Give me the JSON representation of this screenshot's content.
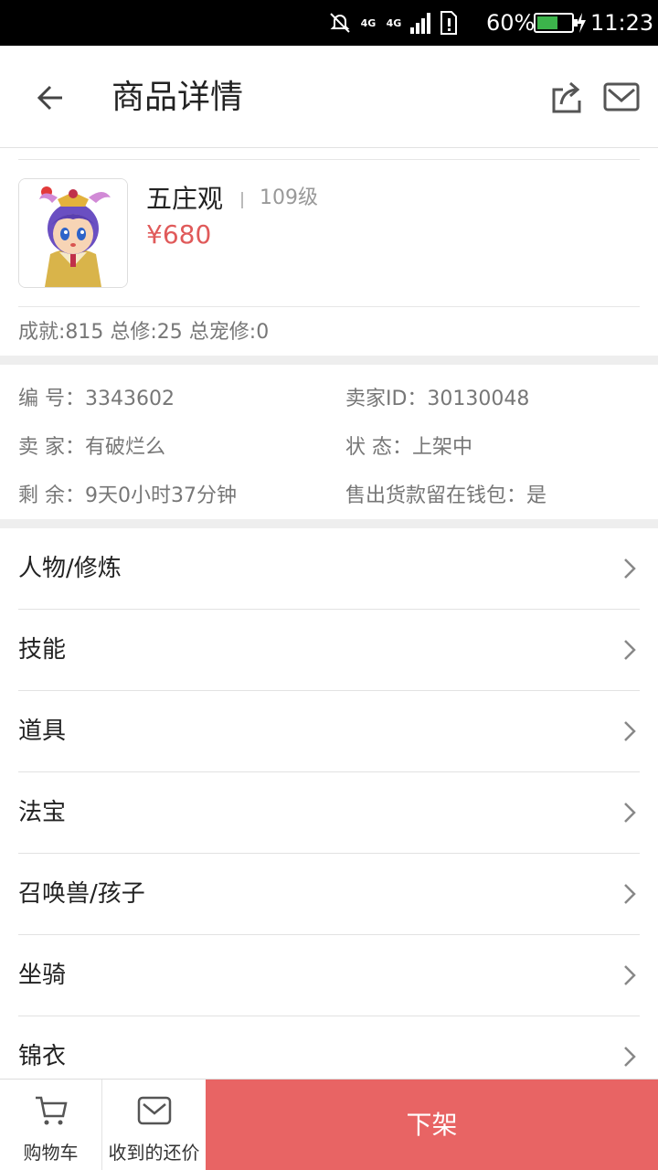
{
  "status_bar": {
    "network_left": "4G",
    "network_right": "4G",
    "battery_percent": "60%",
    "battery_level": 0.6,
    "time": "11:23",
    "icons": [
      "mute-notification-icon",
      "signal-icon",
      "sim-alert-icon",
      "battery-icon",
      "charging-icon"
    ]
  },
  "header": {
    "title": "商品详情",
    "icons": [
      "back-arrow-icon",
      "share-icon",
      "mail-icon"
    ]
  },
  "product": {
    "name": "五庄观",
    "level": "109级",
    "price": "¥680",
    "stats": "成就:815 总修:25 总宠修:0",
    "avatar_icon": "character-avatar"
  },
  "info": {
    "id_label": "编  号：3343602",
    "seller_id_label": "卖家ID：30130048",
    "seller_label": "卖  家：有破烂么",
    "status_label": "状  态：上架中",
    "remaining_label": "剩  余：9天0小时37分钟",
    "wallet_label": "售出货款留在钱包：是"
  },
  "categories": [
    {
      "label": "人物/修炼"
    },
    {
      "label": "技能"
    },
    {
      "label": "道具"
    },
    {
      "label": "法宝"
    },
    {
      "label": "召唤兽/孩子"
    },
    {
      "label": "坐骑"
    },
    {
      "label": "锦衣"
    }
  ],
  "bottom_bar": {
    "cart_label": "购物车",
    "offers_label": "收到的还价",
    "primary_label": "下架",
    "primary_color": "#e86464"
  },
  "colors": {
    "price": "#e05a5a",
    "accent": "#e86464",
    "muted_text": "#777777"
  }
}
